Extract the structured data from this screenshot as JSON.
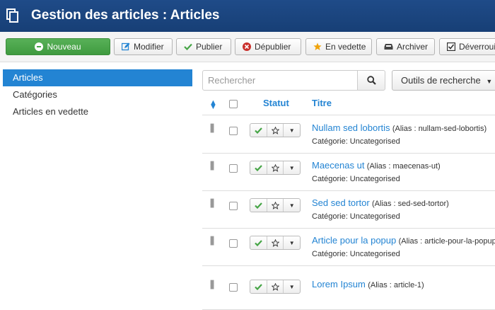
{
  "header": {
    "title": "Gestion des articles : Articles"
  },
  "toolbar": {
    "new": "Nouveau",
    "edit": "Modifier",
    "publish": "Publier",
    "unpublish": "Dépublier",
    "feature": "En vedette",
    "archive": "Archiver",
    "checkin": "Déverrouiller"
  },
  "sidebar": {
    "items": [
      {
        "label": "Articles"
      },
      {
        "label": "Catégories"
      },
      {
        "label": "Articles en vedette"
      }
    ]
  },
  "search": {
    "placeholder": "Rechercher",
    "tools_label": "Outils de recherche"
  },
  "table": {
    "headers": {
      "status": "Statut",
      "title": "Titre"
    },
    "rows": [
      {
        "title": "Nullam sed lobortis",
        "alias": "(Alias : nullam-sed-lobortis)",
        "category": "Catégorie: Uncategorised"
      },
      {
        "title": "Maecenas ut",
        "alias": "(Alias : maecenas-ut)",
        "category": "Catégorie: Uncategorised"
      },
      {
        "title": "Sed sed tortor",
        "alias": "(Alias : sed-sed-tortor)",
        "category": "Catégorie: Uncategorised"
      },
      {
        "title": "Article pour la popup",
        "alias": "(Alias : article-pour-la-popup)",
        "category": "Catégorie: Uncategorised"
      },
      {
        "title": "Lorem Ipsum",
        "alias": "(Alias : article-1)",
        "category": ""
      }
    ]
  },
  "colors": {
    "header_bg": "#1f4b88",
    "accent_blue": "#2384d3",
    "new_button_green": "#46a546",
    "published_green": "#46a546",
    "unpublish_red": "#c9302c",
    "star_orange": "#f0a30a"
  }
}
